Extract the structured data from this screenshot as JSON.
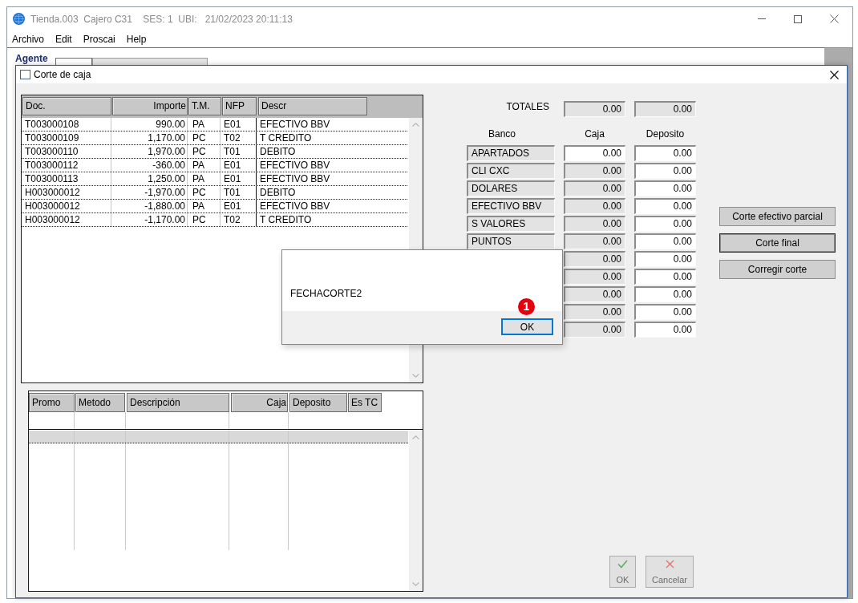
{
  "window": {
    "title": "Tienda.003  Cajero C31    SES: 1  UBI:   21/02/2023 20:11:13"
  },
  "menu": [
    {
      "label": "Archivo"
    },
    {
      "label": "Edit"
    },
    {
      "label": "Proscai"
    },
    {
      "label": "Help"
    }
  ],
  "agent_form": {
    "label": "Agente"
  },
  "dialog": {
    "title": "Corte de caja",
    "documents_table": {
      "columns": [
        {
          "label": "Doc.",
          "kind": "text"
        },
        {
          "label": "Importe",
          "kind": "number"
        },
        {
          "label": "T.M.",
          "kind": "text"
        },
        {
          "label": "NFP",
          "kind": "text"
        },
        {
          "label": "Descr",
          "kind": "text"
        }
      ],
      "rows": [
        [
          "T003000108",
          "990.00",
          "PA",
          "E01",
          "EFECTIVO BBV"
        ],
        [
          "T003000109",
          "1,170.00",
          "PC",
          "T02",
          "T CREDITO"
        ],
        [
          "T003000110",
          "1,970.00",
          "PC",
          "T01",
          "DEBITO"
        ],
        [
          "T003000112",
          "-360.00",
          "PA",
          "E01",
          "EFECTIVO BBV"
        ],
        [
          "T003000113",
          "1,250.00",
          "PA",
          "E01",
          "EFECTIVO BBV"
        ],
        [
          "H003000012",
          "-1,970.00",
          "PC",
          "T01",
          "DEBITO"
        ],
        [
          "H003000012",
          "-1,880.00",
          "PA",
          "E01",
          "EFECTIVO BBV"
        ],
        [
          "H003000012",
          "-1,170.00",
          "PC",
          "T02",
          "T CREDITO"
        ]
      ]
    },
    "promo_table": {
      "columns": [
        {
          "label": "Promo",
          "kind": "text"
        },
        {
          "label": "Metodo",
          "kind": "text"
        },
        {
          "label": "Descripción",
          "kind": "text"
        },
        {
          "label": "Caja",
          "kind": "number"
        },
        {
          "label": "Deposito",
          "kind": "text"
        },
        {
          "label": "Es TC",
          "kind": "text"
        }
      ],
      "rows": [
        {
          "selected": true
        }
      ]
    },
    "totals": {
      "label": "TOTALES",
      "caja": "0.00",
      "deposito": "0.00"
    },
    "bank_columns": [
      "Banco",
      "Caja",
      "Deposito"
    ],
    "banks": [
      {
        "bank": "APARTADOS",
        "caja": "0.00",
        "caja_disabled": false,
        "deposito": "0.00"
      },
      {
        "bank": "CLI CXC",
        "caja": "0.00",
        "caja_disabled": true,
        "deposito": "0.00"
      },
      {
        "bank": "DOLARES",
        "caja": "0.00",
        "caja_disabled": true,
        "deposito": "0.00"
      },
      {
        "bank": "EFECTIVO BBV",
        "caja": "0.00",
        "caja_disabled": true,
        "deposito": "0.00"
      },
      {
        "bank": "S VALORES",
        "caja": "0.00",
        "caja_disabled": true,
        "deposito": "0.00"
      },
      {
        "bank": "PUNTOS",
        "caja": "0.00",
        "caja_disabled": true,
        "deposito": "0.00"
      },
      {
        "caja": "0.00",
        "caja_disabled": true,
        "deposito": "0.00"
      },
      {
        "caja": "0.00",
        "caja_disabled": true,
        "deposito": "0.00"
      },
      {
        "caja": "0.00",
        "caja_disabled": true,
        "deposito": "0.00"
      },
      {
        "caja": "0.00",
        "caja_disabled": true,
        "deposito": "0.00"
      },
      {
        "caja": "0.00",
        "caja_disabled": true,
        "deposito": "0.00"
      }
    ],
    "actions": [
      {
        "label": "Corte efectivo parcial",
        "focused": false
      },
      {
        "label": "Corte final",
        "focused": true
      },
      {
        "label": "Corregir corte",
        "focused": false
      }
    ],
    "footer_buttons": [
      {
        "label": "OK",
        "kind": "ok",
        "disabled": true
      },
      {
        "label": "Cancelar",
        "kind": "cancel",
        "disabled": true
      }
    ]
  },
  "message_box": {
    "text": "FECHACORTE2",
    "buttons": [
      {
        "label": "OK",
        "focused": true
      }
    ],
    "step_marker": "1"
  }
}
